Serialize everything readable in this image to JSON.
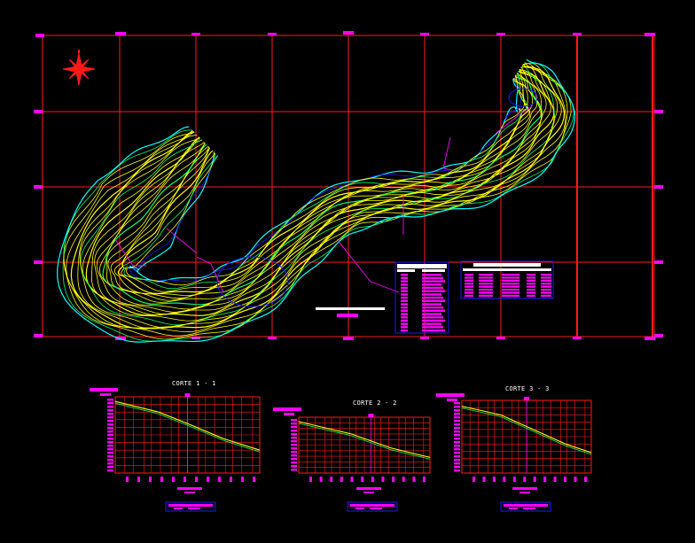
{
  "drawing": {
    "background": "#000000",
    "colors": {
      "grid": "#ff1a1a",
      "accent": "#ff00ff",
      "contour_yellow": "#ffff00",
      "contour_green": "#00ff66",
      "contour_cyan": "#00ffff",
      "contour_blue": "#1a1aff",
      "table_fill": "#ff00ff",
      "text": "#ffffff"
    },
    "north_arrow_icon": "compass-rose-icon"
  },
  "sections": [
    {
      "title": "CORTE 1 - 1"
    },
    {
      "title": "CORTE 2 - 2"
    },
    {
      "title": "CORTE 3 - 3"
    }
  ]
}
